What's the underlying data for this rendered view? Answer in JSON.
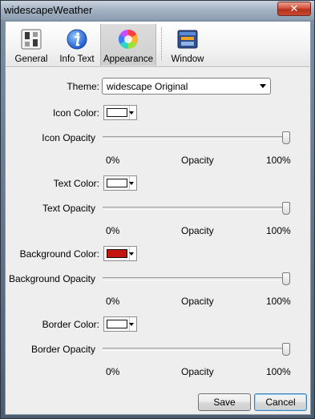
{
  "window": {
    "title": "widescapeWeather",
    "close_glyph": "✕"
  },
  "toolbar": {
    "tabs": [
      {
        "label": "General",
        "icon": "switches-icon",
        "active": false
      },
      {
        "label": "Info Text",
        "icon": "info-icon",
        "active": false
      },
      {
        "label": "Appearance",
        "icon": "color-wheel-icon",
        "active": true
      },
      {
        "label": "Window",
        "icon": "window-icon",
        "active": false
      }
    ]
  },
  "appearance": {
    "theme": {
      "label": "Theme:",
      "value": "widescape Original"
    },
    "icon_color": {
      "label": "Icon Color:",
      "value": "#ffffff"
    },
    "icon_opacity": {
      "label": "Icon Opacity",
      "value_percent": 100
    },
    "text_color": {
      "label": "Text Color:",
      "value": "#ffffff"
    },
    "text_opacity": {
      "label": "Text Opacity",
      "value_percent": 100
    },
    "background_color": {
      "label": "Background Color:",
      "value": "#c4160f"
    },
    "background_opacity": {
      "label": "Background Opacity",
      "value_percent": 100
    },
    "border_color": {
      "label": "Border Color:",
      "value": "#ffffff"
    },
    "border_opacity": {
      "label": "Border Opacity",
      "value_percent": 100
    },
    "scale": {
      "min": "0%",
      "mid": "Opacity",
      "max": "100%"
    }
  },
  "footer": {
    "save_label": "Save",
    "cancel_label": "Cancel"
  }
}
